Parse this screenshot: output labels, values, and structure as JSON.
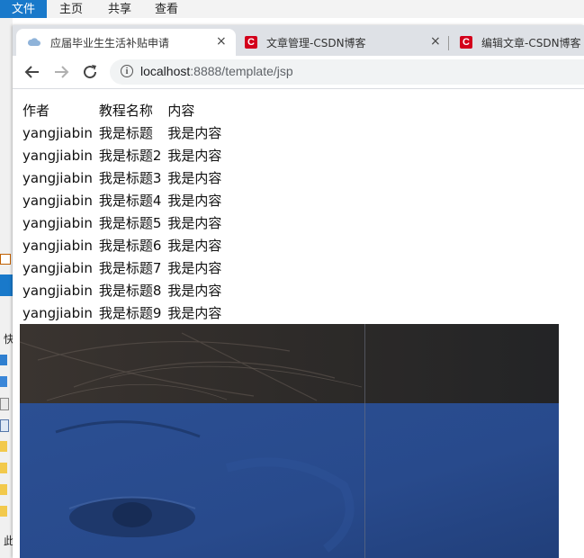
{
  "background_window": {
    "ribbon_tabs": [
      "文件",
      "主页",
      "共享",
      "查看"
    ],
    "left_labels": [
      "快",
      "此"
    ]
  },
  "browser": {
    "tabs": [
      {
        "title": "应届毕业生生活补贴申请",
        "close": "×",
        "icon": "cloud-icon"
      },
      {
        "title": "文章管理-CSDN博客",
        "close": "×",
        "icon": "csdn-icon"
      },
      {
        "title": "编辑文章-CSDN博客",
        "icon": "csdn-icon"
      }
    ],
    "csdn_glyph": "C",
    "info_glyph": "i",
    "address": {
      "host": "localhost",
      "path": ":8888/template/jsp"
    }
  },
  "table": {
    "headers": [
      "作者",
      "教程名称",
      "内容"
    ],
    "rows": [
      [
        "yangjiabin",
        "我是标题",
        "我是内容"
      ],
      [
        "yangjiabin",
        "我是标题2",
        "我是内容"
      ],
      [
        "yangjiabin",
        "我是标题3",
        "我是内容"
      ],
      [
        "yangjiabin",
        "我是标题4",
        "我是内容"
      ],
      [
        "yangjiabin",
        "我是标题5",
        "我是内容"
      ],
      [
        "yangjiabin",
        "我是标题6",
        "我是内容"
      ],
      [
        "yangjiabin",
        "我是标题7",
        "我是内容"
      ],
      [
        "yangjiabin",
        "我是标题8",
        "我是内容"
      ],
      [
        "yangjiabin",
        "我是标题9",
        "我是内容"
      ]
    ]
  },
  "colors": {
    "photo_top": "#2c2a28",
    "photo_blue": "#2a4c8e",
    "csdn_red": "#d3001b",
    "explorer_blue": "#1979ca"
  }
}
